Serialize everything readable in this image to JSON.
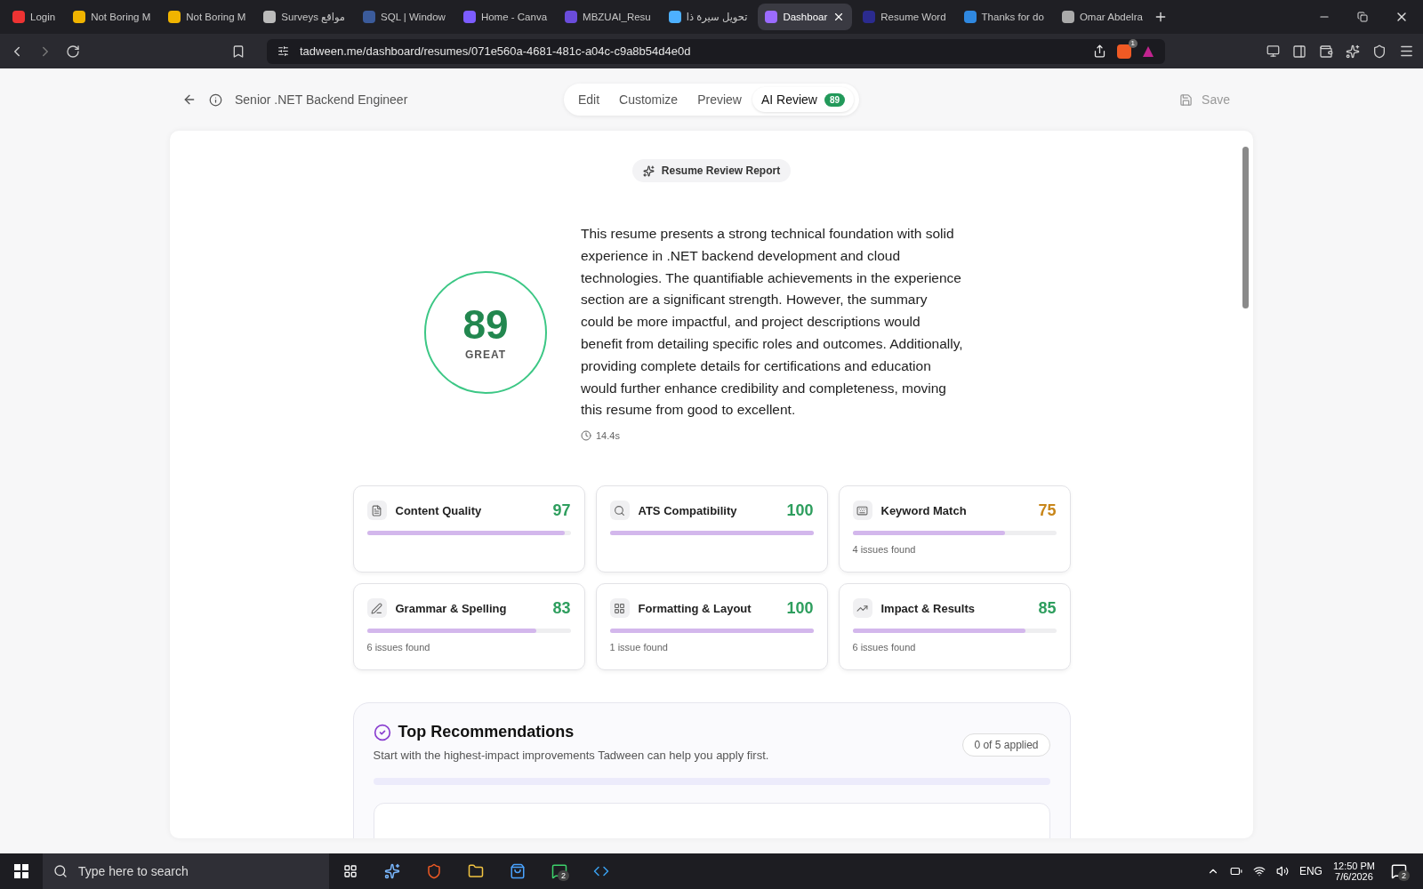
{
  "browser": {
    "tabs": [
      {
        "title": "Login",
        "selected": false
      },
      {
        "title": "Not Boring M",
        "selected": false
      },
      {
        "title": "Not Boring M",
        "selected": false
      },
      {
        "title": "Surveys مواقع",
        "selected": false
      },
      {
        "title": "SQL | Window",
        "selected": false
      },
      {
        "title": "Home - Canva",
        "selected": false
      },
      {
        "title": "MBZUAI_Resu",
        "selected": false
      },
      {
        "title": "تحويل سيرة ذا",
        "selected": false
      },
      {
        "title": "Dashboar",
        "selected": true
      },
      {
        "title": "Resume Word",
        "selected": false
      },
      {
        "title": "Thanks for do",
        "selected": false
      },
      {
        "title": "Omar Abdelra",
        "selected": false
      }
    ],
    "url": "tadween.me/dashboard/resumes/071e560a-4681-481c-a04c-c9a8b54d4e0d",
    "shield_badge": "1"
  },
  "header": {
    "title": "Senior .NET Backend Engineer",
    "modes": [
      {
        "label": "Edit",
        "selected": false
      },
      {
        "label": "Customize",
        "selected": false
      },
      {
        "label": "Preview",
        "selected": false
      },
      {
        "label": "AI Review",
        "selected": true,
        "badge": "89"
      }
    ],
    "save": "Save"
  },
  "report": {
    "pill": "Resume Review Report",
    "score": "89",
    "grade": "GREAT",
    "summary": "This resume presents a strong technical foundation with solid experience in .NET backend development and cloud technologies. The quantifiable achievements in the experience section are a significant strength. However, the summary could be more impactful, and project descriptions would benefit from detailing specific roles and outcomes. Additionally, providing complete details for certifications and education would further enhance credibility and completeness, moving this resume from good to excellent.",
    "time": "14.4s",
    "metrics": [
      {
        "kind": "content",
        "name": "Content Quality",
        "score": "97",
        "color": "#2e9e5e",
        "level": 0.97
      },
      {
        "kind": "ats",
        "name": "ATS Compatibility",
        "score": "100",
        "color": "#2e9e5e",
        "level": 1
      },
      {
        "kind": "keyword",
        "name": "Keyword Match",
        "score": "75",
        "color": "#c8861a",
        "level": 0.75,
        "issues": "4 issues found"
      },
      {
        "kind": "grammar",
        "name": "Grammar & Spelling",
        "score": "83",
        "color": "#2e9e5e",
        "level": 0.83,
        "issues": "6 issues found"
      },
      {
        "kind": "format",
        "name": "Formatting & Layout",
        "score": "100",
        "color": "#2e9e5e",
        "level": 1,
        "issues": "1 issue found"
      },
      {
        "kind": "impact",
        "name": "Impact & Results",
        "score": "85",
        "color": "#2e9e5e",
        "level": 0.85,
        "issues": "6 issues found"
      }
    ],
    "recommendations": {
      "title": "Top Recommendations",
      "subtitle": "Start with the highest-impact improvements Tadween can help you apply first.",
      "applied": "0 of 5 applied",
      "level": 0
    }
  },
  "taskbar": {
    "search": "Type here to search",
    "whatsapp_badge": "2",
    "language": "ENG",
    "time": "12:50 PM",
    "date": "7/6/2026",
    "notifications": "2"
  }
}
